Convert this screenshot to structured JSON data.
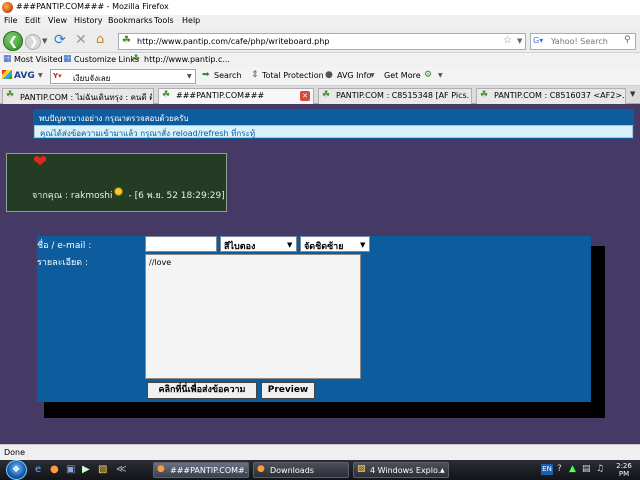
{
  "window": {
    "title": "###PANTIP.COM### - Mozilla Firefox"
  },
  "menu": [
    "File",
    "Edit",
    "View",
    "History",
    "Bookmarks",
    "Tools",
    "Help"
  ],
  "nav": {
    "url": "http://www.pantip.com/cafe/php/writeboard.php",
    "search_placeholder": "Yahoo! Search"
  },
  "bookmarks": [
    {
      "label": "Most Visited"
    },
    {
      "label": "Customize Links"
    },
    {
      "label": "http://www.pantip.c..."
    }
  ],
  "avg": {
    "logo": "AVG",
    "search_text": "เงียบจังเลย",
    "search_button": "Search",
    "total_protection": "Total Protection",
    "avg_info": "AVG Info",
    "get_more": "Get More"
  },
  "tabs": [
    {
      "label": "PANTIP.COM : ไม่ฉันเดินทรุง : คนดี คื...",
      "active": false
    },
    {
      "label": "###PANTIP.COM###",
      "active": true
    },
    {
      "label": "PANTIP.COM : C8515348 [AF Pics...",
      "active": false
    },
    {
      "label": "PANTIP.COM : C8516037 <AF2>...",
      "active": false
    }
  ],
  "page": {
    "msg1": "พบปัญหาบางอย่าง กรุณาตรวจสอบด้วยครับ",
    "msg2": "คุณได้ส่งข้อความเข้ามาแล้ว กรุณาสั่ง reload/refresh ที่กระทู้",
    "from_prefix": "จากคุณ : rakmoshi",
    "from_date": "- [6 พ.ย. 52 18:29:29]",
    "form": {
      "name_label": "ชื่อ / e-mail :",
      "detail_label": "รายละเอียด :",
      "name_value": "",
      "color_select": "สีไบตอง",
      "align_select": "จัดชิดซ้าย",
      "detail_value": "//love",
      "submit_label": "คลิกที่นี่เพื่อส่งข้อความ",
      "preview_label": "Preview"
    }
  },
  "status": {
    "text": "Done"
  },
  "taskbar": {
    "tasks": [
      {
        "label": "###PANTIP.COM#...",
        "active": true
      },
      {
        "label": "Downloads",
        "active": false
      },
      {
        "label": "4 Windows Explo...",
        "active": false
      }
    ],
    "lang": "EN",
    "clock_time": "2:26",
    "clock_ampm": "PM"
  },
  "colors": {
    "page_bg": "#453a66",
    "box_blue": "#0d5c9e",
    "green_box": "#233c23",
    "heart": "#e6251f"
  }
}
